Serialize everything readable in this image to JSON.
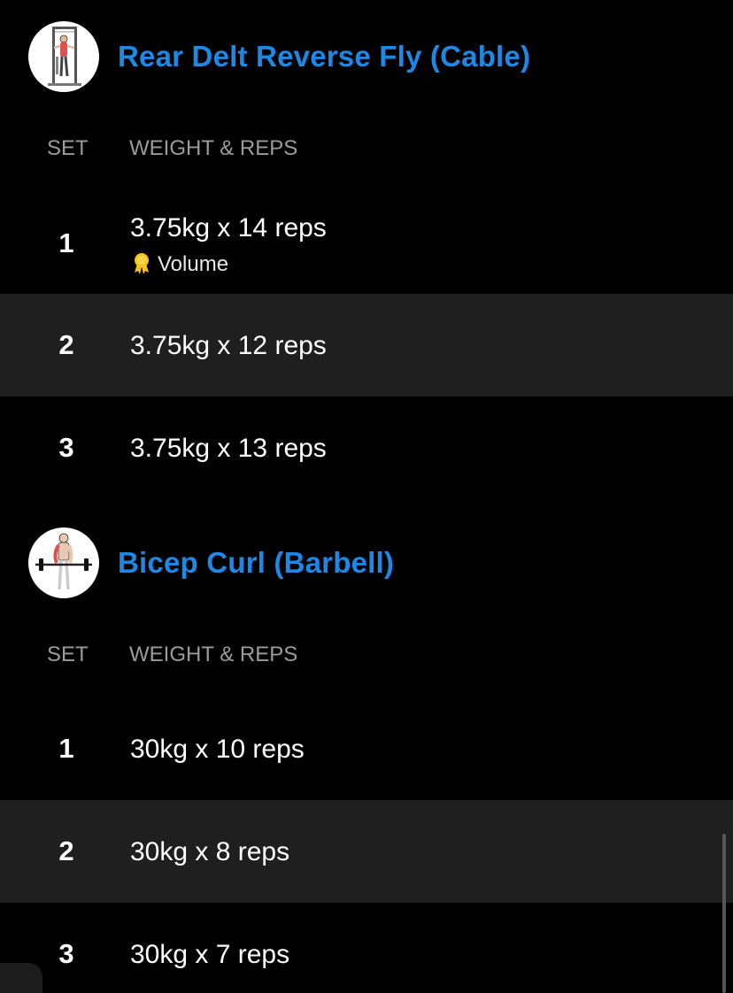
{
  "exercises": [
    {
      "title": "Rear Delt Reverse Fly (Cable)",
      "thumbnail_icon": "cable-machine-exercise-icon",
      "columns": {
        "set": "SET",
        "weight_reps": "WEIGHT & REPS"
      },
      "sets": [
        {
          "number": "1",
          "value": "3.75kg x 14 reps",
          "badge": {
            "icon": "medal-icon",
            "label": "Volume",
            "color": "#f5c518"
          }
        },
        {
          "number": "2",
          "value": "3.75kg x 12 reps"
        },
        {
          "number": "3",
          "value": "3.75kg x 13 reps"
        }
      ]
    },
    {
      "title": "Bicep Curl (Barbell)",
      "thumbnail_icon": "barbell-curl-exercise-icon",
      "columns": {
        "set": "SET",
        "weight_reps": "WEIGHT & REPS"
      },
      "sets": [
        {
          "number": "1",
          "value": "30kg x 10 reps"
        },
        {
          "number": "2",
          "value": "30kg x 8 reps"
        },
        {
          "number": "3",
          "value": "30kg x 7 reps"
        }
      ]
    }
  ],
  "colors": {
    "background": "#000000",
    "accent_title": "#1e88e5",
    "row_alt": "#1f1f1f",
    "muted_text": "#9b9b9b"
  }
}
